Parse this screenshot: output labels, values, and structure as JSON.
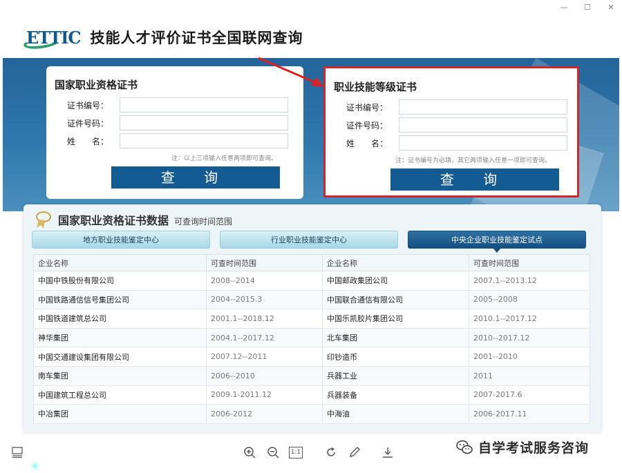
{
  "window": {
    "minimize": "—",
    "maximize": "☐",
    "close": "✕"
  },
  "header": {
    "logo_text": "ETTIC",
    "title": "技能人才评价证书全国联网查询"
  },
  "left_card": {
    "title": "国家职业资格证书",
    "fields": [
      {
        "label": "证书编号：",
        "value": ""
      },
      {
        "label": "证件号码：",
        "value": ""
      },
      {
        "label": "姓　　名：",
        "value": ""
      }
    ],
    "note": "注：以上三项输入任意两项即可查询。",
    "button": "查 询"
  },
  "right_card": {
    "title": "职业技能等级证书",
    "fields": [
      {
        "label": "证书编号：",
        "value": ""
      },
      {
        "label": "证件号码：",
        "value": ""
      },
      {
        "label": "姓　　名：",
        "value": ""
      }
    ],
    "note": "注：证书编号为必填，其它两项输入任意一项即可查询。",
    "button": "查 询"
  },
  "panel": {
    "title": "国家职业资格证书数据",
    "subtitle": "可查询时间范围",
    "tabs": [
      "地方职业技能鉴定中心",
      "行业职业技能鉴定中心",
      "中央企业职业技能鉴定试点"
    ],
    "active_tab": 2,
    "columns": [
      "企业名称",
      "可查时间范围",
      "企业名称",
      "可查时间范围"
    ],
    "rows": [
      [
        "中国中铁股份有限公司",
        "2008--2014",
        "中国邮政集团公司",
        "2007.1--2013.12"
      ],
      [
        "中国铁路通信信号集团公司",
        "2004--2015.3",
        "中国联合通信有限公司",
        "2005--2008"
      ],
      [
        "中国铁道建筑总公司",
        "2001.1--2018.12",
        "中国乐凯胶片集团公司",
        "2010.1--2017.12"
      ],
      [
        "神华集团",
        "2004.1--2017.12",
        "北车集团",
        "2010--2017.12"
      ],
      [
        "中国交通建设集团有限公司",
        "2007.12--2011",
        "印钞造币",
        "2001--2010"
      ],
      [
        "南车集团",
        "2006--2010",
        "兵器工业",
        "2011"
      ],
      [
        "中国建筑工程总公司",
        "2009.1-2011.12",
        "兵器装备",
        "2007-2017.6"
      ],
      [
        "中冶集团",
        "2006-2012",
        "中海油",
        "2006-2017.11"
      ]
    ]
  },
  "toolbar": {
    "actual_size_label": "1:1"
  },
  "watermark": {
    "text": "自学考试服务咨询"
  },
  "colors": {
    "accent_red": "#d3262a",
    "button_blue": "#145b94",
    "banner_blue": "#2f78ad"
  }
}
